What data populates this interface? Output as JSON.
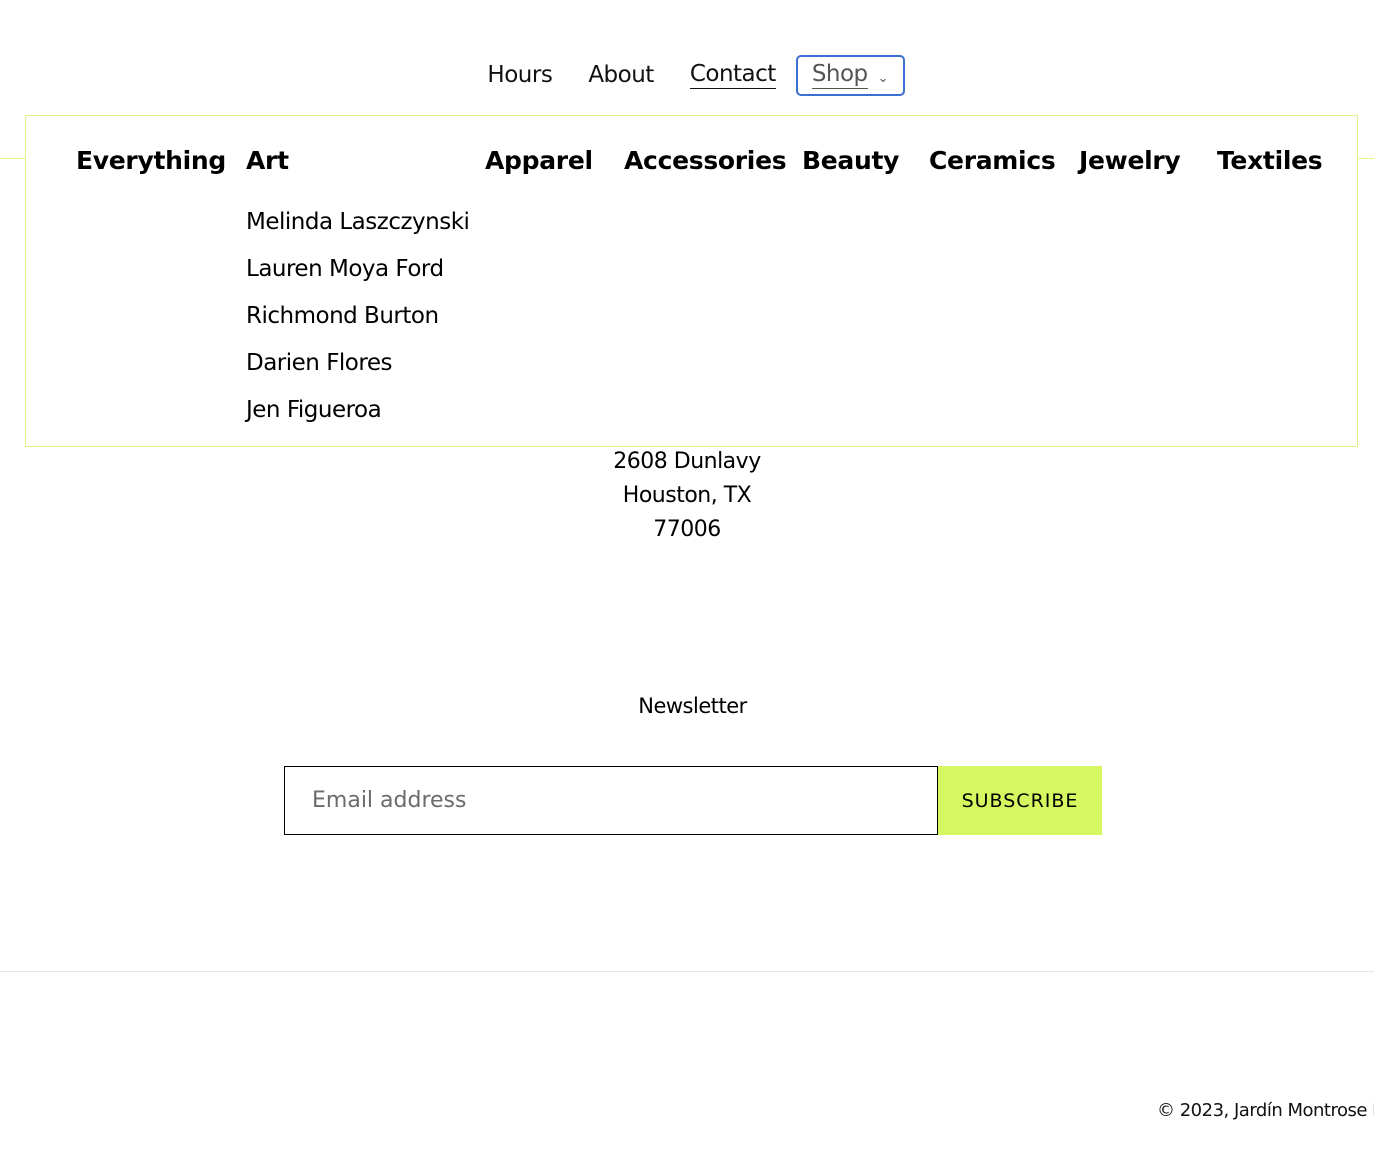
{
  "nav": {
    "items": [
      "Hours",
      "About",
      "Contact"
    ],
    "shop_label": "Shop"
  },
  "mega_menu": {
    "categories": [
      "Everything",
      "Art",
      "Apparel",
      "Accessories",
      "Beauty",
      "Ceramics",
      "Jewelry",
      "Textiles"
    ],
    "art_artists": [
      "Melinda Laszczynski",
      "Lauren Moya Ford",
      "Richmond Burton",
      "Darien Flores",
      "Jen Figueroa"
    ]
  },
  "address": {
    "line1": "2608 Dunlavy",
    "line2": "Houston, TX",
    "line3": "77006"
  },
  "newsletter": {
    "title": "Newsletter",
    "email_placeholder": "Email address",
    "subscribe_label": "SUBSCRIBE"
  },
  "footer": {
    "copyright_prefix": "© 2023, ",
    "brand": "Jardín Montrose Po"
  },
  "colors": {
    "accent": "#d6f75f",
    "focus_ring": "#3b6fd0",
    "menu_border": "#e2f08c"
  }
}
